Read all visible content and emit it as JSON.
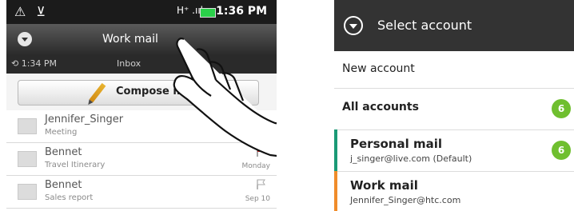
{
  "left_panel": {
    "statusbar": {
      "time": "1:36 PM",
      "network": "H⁺ .ııl"
    },
    "titlebar": {
      "title": "Work mail"
    },
    "subbar": {
      "last_sync": "1:34 PM",
      "folder": "Inbox"
    },
    "compose": {
      "label": "Compose mail"
    },
    "emails": [
      {
        "sender": "Jennifer_Singer",
        "subject": "Meeting",
        "date": "Mo",
        "flag": "none"
      },
      {
        "sender": "Bennet",
        "subject": "Travel Itinerary",
        "date": "Monday",
        "flag": "red"
      },
      {
        "sender": "Bennet",
        "subject": "Sales report",
        "date": "Sep 10",
        "flag": "outline"
      }
    ]
  },
  "right_panel": {
    "header": {
      "title": "Select account"
    },
    "new_account": "New account",
    "all_accounts": {
      "label": "All accounts",
      "count": "6"
    },
    "accounts": [
      {
        "name": "Personal mail",
        "email": "j_singer@live.com (Default)",
        "count": "6",
        "accent": "#1a9a76"
      },
      {
        "name": "Work mail",
        "email": "Jennifer_Singer@htc.com",
        "count": "",
        "accent": "#f08c2a"
      }
    ]
  }
}
